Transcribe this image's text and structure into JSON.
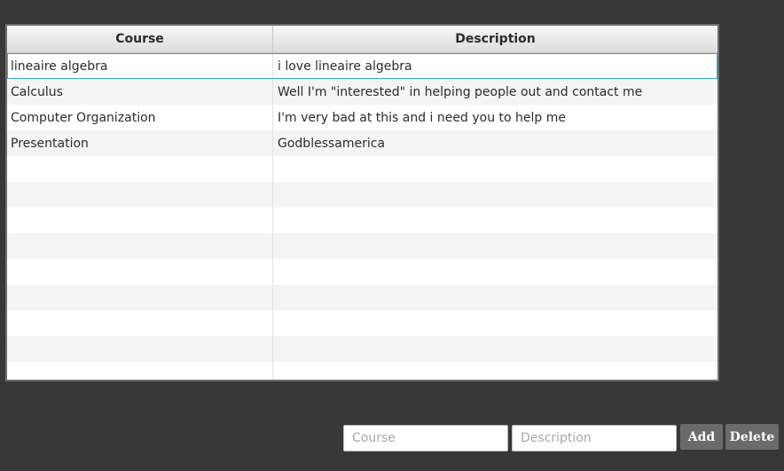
{
  "table": {
    "columns": [
      "Course",
      "Description"
    ],
    "rows": [
      {
        "course": "lineaire algebra",
        "description": "i love lineaire algebra"
      },
      {
        "course": "Calculus",
        "description": "Well I'm \"interested\" in helping people out and contact me"
      },
      {
        "course": "Computer Organization",
        "description": "I'm very bad at this and i need you to help me"
      },
      {
        "course": "Presentation",
        "description": "Godblessamerica"
      },
      {
        "course": "",
        "description": ""
      },
      {
        "course": "",
        "description": ""
      },
      {
        "course": "",
        "description": ""
      },
      {
        "course": "",
        "description": ""
      },
      {
        "course": "",
        "description": ""
      },
      {
        "course": "",
        "description": ""
      },
      {
        "course": "",
        "description": ""
      },
      {
        "course": "",
        "description": ""
      },
      {
        "course": "",
        "description": ""
      }
    ],
    "selected_row": 0
  },
  "form": {
    "course_placeholder": "Course",
    "description_placeholder": "Description",
    "course_value": "",
    "description_value": "",
    "add_label": "Add",
    "delete_label": "Delete"
  },
  "colors": {
    "background": "#383838",
    "button": "#6b6b6b",
    "selection": "#3fa6c9"
  }
}
